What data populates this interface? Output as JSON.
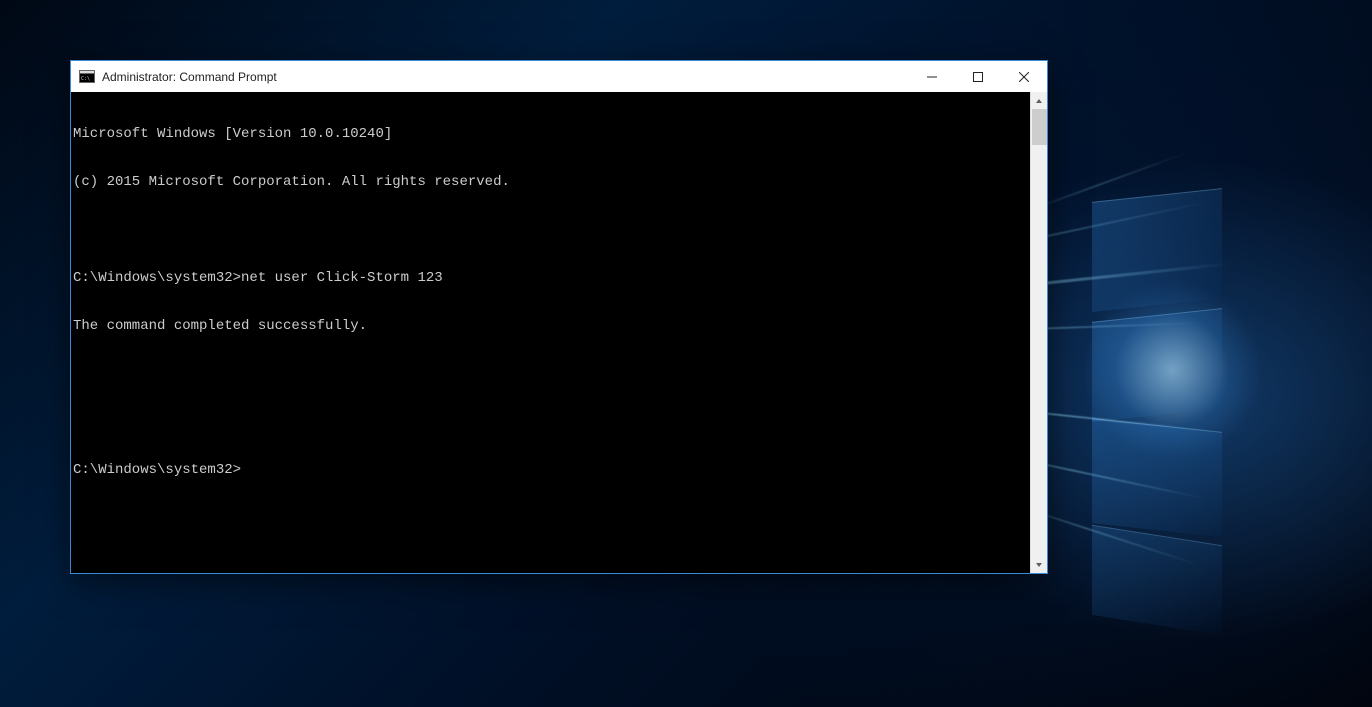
{
  "window": {
    "title": "Administrator: Command Prompt"
  },
  "console": {
    "lines": [
      "Microsoft Windows [Version 10.0.10240]",
      "(c) 2015 Microsoft Corporation. All rights reserved.",
      "",
      "C:\\Windows\\system32>net user Click-Storm 123",
      "The command completed successfully.",
      "",
      "",
      "C:\\Windows\\system32>"
    ]
  }
}
